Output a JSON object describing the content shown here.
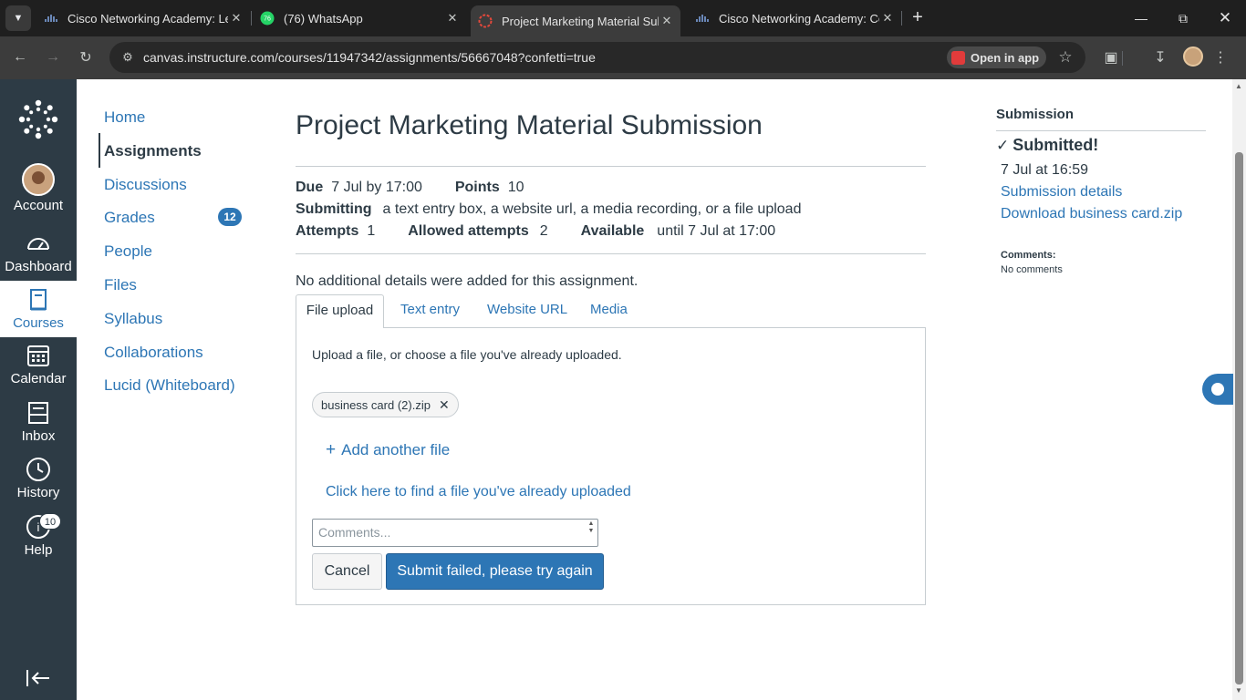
{
  "browser": {
    "tabs": [
      {
        "title": "Cisco Networking Academy: Learn",
        "favicon": "cisco-icon"
      },
      {
        "title": "(76) WhatsApp",
        "favicon": "whatsapp-icon",
        "badge": "76"
      },
      {
        "title": "Project Marketing Material Submission",
        "favicon": "canvas-icon"
      },
      {
        "title": "Cisco Networking Academy: Course",
        "favicon": "cisco-icon"
      }
    ],
    "url": "canvas.instructure.com/courses/11947342/assignments/56667048?confetti=true",
    "open_in_app": "Open in app"
  },
  "global_nav": {
    "items": [
      {
        "label": "Account",
        "icon": "avatar"
      },
      {
        "label": "Dashboard",
        "icon": "dashboard-icon"
      },
      {
        "label": "Courses",
        "icon": "courses-icon"
      },
      {
        "label": "Calendar",
        "icon": "calendar-icon"
      },
      {
        "label": "Inbox",
        "icon": "inbox-icon"
      },
      {
        "label": "History",
        "icon": "history-icon"
      },
      {
        "label": "Help",
        "icon": "help-icon"
      }
    ],
    "help_badge": "10"
  },
  "course_nav": {
    "items": [
      "Home",
      "Assignments",
      "Discussions",
      "Grades",
      "People",
      "Files",
      "Syllabus",
      "Collaborations",
      "Lucid (Whiteboard)"
    ],
    "grades_badge": "12"
  },
  "assignment": {
    "title": "Project Marketing Material Submission",
    "due_label": "Due",
    "due_value": "7 Jul by 17:00",
    "points_label": "Points",
    "points_value": "10",
    "submitting_label": "Submitting",
    "submitting_value": "a text entry box, a website url, a media recording, or a file upload",
    "attempts_label": "Attempts",
    "attempts_value": "1",
    "allowed_label": "Allowed attempts",
    "allowed_value": "2",
    "available_label": "Available",
    "available_value": "until 7 Jul at 17:00",
    "details": "No additional details were added for this assignment."
  },
  "submission_tabs": [
    "File upload",
    "Text entry",
    "Website URL",
    "Media"
  ],
  "upload": {
    "hint": "Upload a file, or choose a file you've already uploaded.",
    "file_name": "business card (2).zip",
    "add_another": "Add another file",
    "find_uploaded": "Click here to find a file you've already uploaded",
    "comments_placeholder": "Comments...",
    "cancel": "Cancel",
    "submit": "Submit failed, please try again"
  },
  "sidebar": {
    "heading": "Submission",
    "status": "Submitted!",
    "time": "7 Jul at 16:59",
    "details_link": "Submission details",
    "download_link": "Download business card.zip",
    "comments_label": "Comments:",
    "comments_value": "No comments"
  },
  "colors": {
    "nav_bg": "#2d3b45",
    "link": "#2d76b5",
    "primary_button": "#2d76b5"
  }
}
